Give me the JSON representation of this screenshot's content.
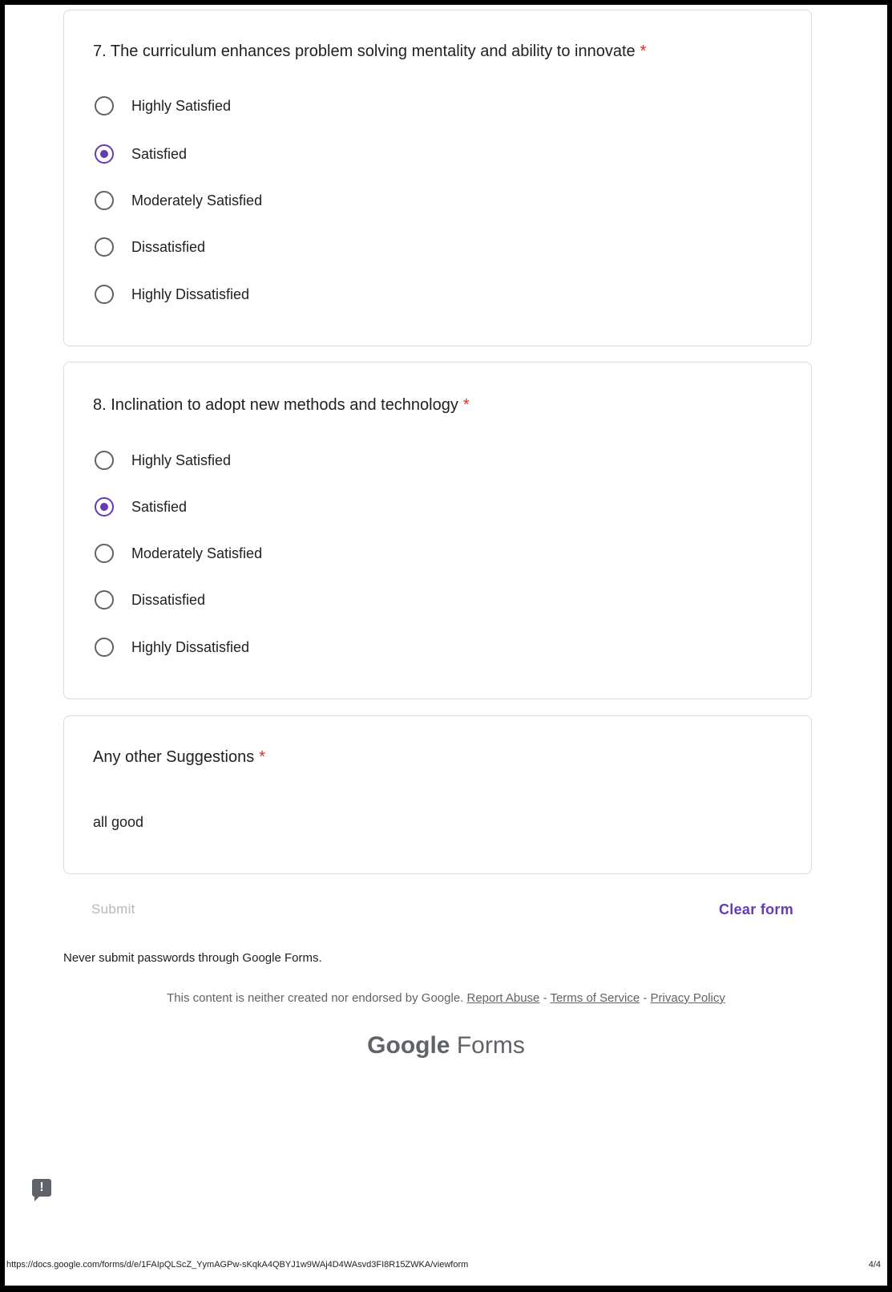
{
  "questions": [
    {
      "title": "7. The curriculum enhances problem solving mentality and ability to innovate",
      "required_mark": "*",
      "options": [
        "Highly Satisfied",
        "Satisfied",
        "Moderately Satisfied",
        "Dissatisfied",
        "Highly Dissatisfied"
      ],
      "selected": "Satisfied"
    },
    {
      "title": "8. Inclination to adopt new methods and technology",
      "required_mark": "*",
      "options": [
        "Highly Satisfied",
        "Satisfied",
        "Moderately Satisfied",
        "Dissatisfied",
        "Highly Dissatisfied"
      ],
      "selected": "Satisfied"
    }
  ],
  "suggestions": {
    "title": "Any other Suggestions",
    "required_mark": "*",
    "answer": "all good"
  },
  "actions": {
    "submit_label": "Submit",
    "clear_label": "Clear form"
  },
  "footer": {
    "warning": "Never submit passwords through Google Forms.",
    "disclaimer": "This content is neither created nor endorsed by Google.",
    "report_abuse": "Report Abuse",
    "terms": "Terms of Service",
    "privacy": "Privacy Policy",
    "separator": " - ",
    "brand_google": "Google",
    "brand_forms": "Forms"
  },
  "feedback_icon": "!",
  "print": {
    "url": "https://docs.google.com/forms/d/e/1FAIpQLScZ_YymAGPw-sKqkA4QBYJ1w9WAj4D4WAsvd3FI8R15ZWKA/viewform",
    "page": "4/4"
  },
  "colors": {
    "accent": "#673ab7",
    "required": "#d93025",
    "border": "#dadce0"
  }
}
